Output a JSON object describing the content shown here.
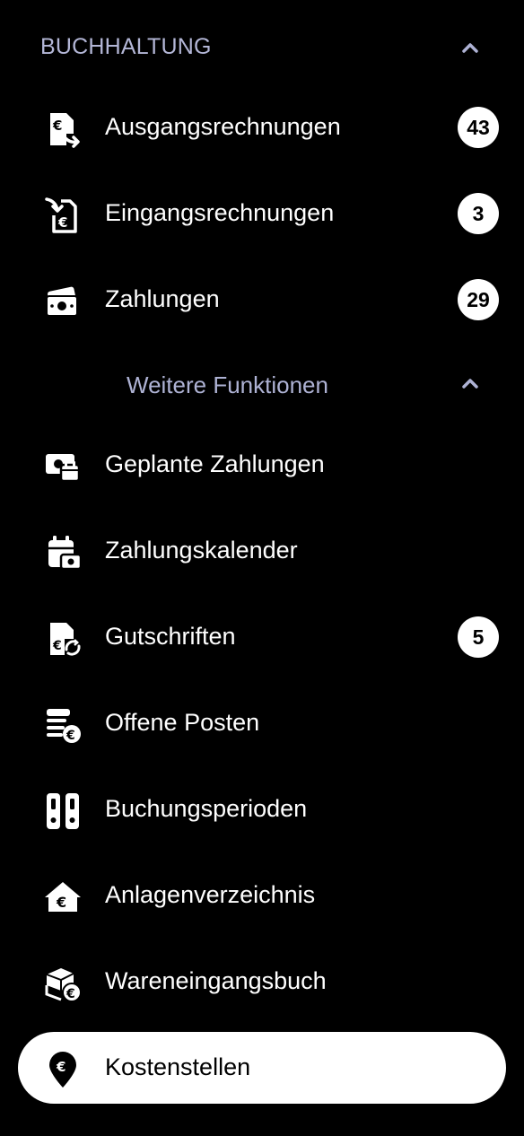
{
  "section": {
    "title": "BUCHHALTUNG",
    "expanded": true
  },
  "main_items": [
    {
      "label": "Ausgangsrechnungen",
      "badge": "43",
      "icon": "outgoing-invoice-icon"
    },
    {
      "label": "Eingangsrechnungen",
      "badge": "3",
      "icon": "incoming-invoice-icon"
    },
    {
      "label": "Zahlungen",
      "badge": "29",
      "icon": "payments-icon"
    }
  ],
  "sub_section": {
    "title": "Weitere Funktionen",
    "expanded": true
  },
  "more_items": [
    {
      "label": "Geplante Zahlungen",
      "icon": "scheduled-payment-icon"
    },
    {
      "label": "Zahlungskalender",
      "icon": "payment-calendar-icon"
    },
    {
      "label": "Gutschriften",
      "badge": "5",
      "icon": "credit-note-icon"
    },
    {
      "label": "Offene Posten",
      "icon": "open-items-icon"
    },
    {
      "label": "Buchungsperioden",
      "icon": "booking-periods-icon"
    },
    {
      "label": "Anlagenverzeichnis",
      "icon": "asset-register-icon"
    },
    {
      "label": "Wareneingangsbuch",
      "icon": "goods-receipt-icon"
    },
    {
      "label": "Kostenstellen",
      "icon": "cost-center-icon",
      "active": true
    }
  ],
  "colors": {
    "background": "#000000",
    "text": "#ffffff",
    "section_title": "#b3b6d6",
    "sub_title": "#aeb2d4",
    "badge_bg": "#ffffff",
    "active_bg": "#ffffff"
  }
}
